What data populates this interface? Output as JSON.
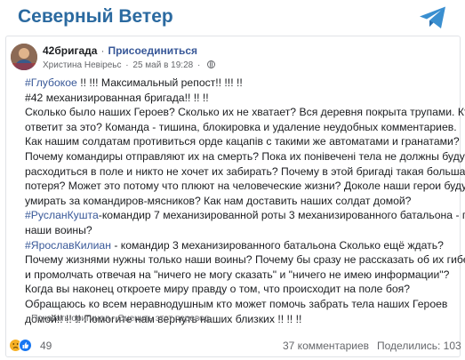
{
  "header": {
    "channel_name": "Северный Ветер",
    "logo_icon": "telegram-icon",
    "accent": "#2b6aa0"
  },
  "post": {
    "group_name": "42бригада",
    "join_label": "Присоединиться",
    "author": "Христина Невіреьс",
    "date": "25 май в 19:28",
    "lines": [
      [
        {
          "t": "#Глубокое",
          "h": true
        },
        {
          "t": " !!  !!! Максимальный репост!!  !!! !!"
        }
      ],
      [
        {
          "t": "#42 механизированная бригада!! !! !!"
        }
      ],
      [
        {
          "t": "Сколько было наших Героев? Сколько их не хватает? Вся деревня покрыта трупами. Кто"
        }
      ],
      [
        {
          "t": "ответит за это? Команда - тишина, блокировка и удаление неудобных комментариев."
        }
      ],
      [
        {
          "t": "Как нашим солдатам противиться орде кацапів с такими же автоматами и гранатами?"
        }
      ],
      [
        {
          "t": "Почему командиры отправляют их на смерть? Пока их понівечені тела не должны будут"
        }
      ],
      [
        {
          "t": "расходиться в поле и никто не хочет их забирать? Почему в этой бригаді такая большая"
        }
      ],
      [
        {
          "t": "потеря? Может это потому что плюют на человеческие жизни? Доколе наши герои будут"
        }
      ],
      [
        {
          "t": "умирать за командиров-мясников? Как нам доставить наших солдат домой?"
        }
      ],
      [
        {
          "t": "#РусланКушта",
          "h": true
        },
        {
          "t": "-командир 7 механизированной роты 3 механизированного батальона - где"
        }
      ],
      [
        {
          "t": "наши воины?"
        }
      ],
      [
        {
          "t": "#ЯрославКилиан",
          "h": true
        },
        {
          "t": " - командир 3 механизированного батальона Сколько ещё ждать?"
        }
      ],
      [
        {
          "t": "Почему жизнями нужны только наши воины? Почему бы сразу не рассказать об их гибели"
        }
      ],
      [
        {
          "t": "и промолчать отвечая на \"ничего не могу сказать\" и \"ничего не имею информации\"?"
        }
      ],
      [
        {
          "t": "Когда вы наконец откроете миру правду о том, что происходит на поле боя?"
        }
      ],
      [
        {
          "t": "Обращаюсь ко всем неравнодушным кто может помочь забрать тела наших Героев"
        }
      ],
      [
        {
          "t": "домой!! !! !!  Помогите нам вернуть наших близких !! !! !!"
        }
      ]
    ],
    "translate": {
      "show_original": "Показать оригинал",
      "separator": "·",
      "rate": "Оценить этот перевод"
    },
    "reactions": {
      "count": "49",
      "icons": [
        "sad-icon",
        "like-icon"
      ]
    },
    "comments": "37 комментариев",
    "shares": "Поделились: 103"
  }
}
